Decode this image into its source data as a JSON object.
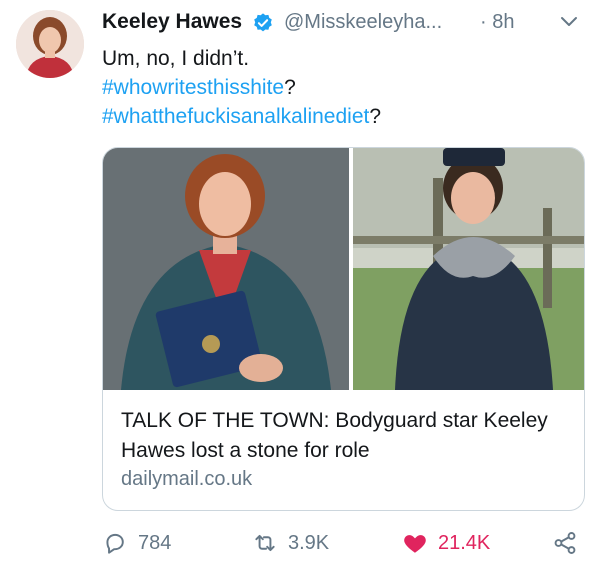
{
  "tweet": {
    "author_name": "Keeley Hawes",
    "handle": "@Misskeeleyha...",
    "separator": "·",
    "time": "8h",
    "text_line1": "Um, no, I didn’t.",
    "hashtag1": "#whowritesthisshite",
    "hashtag1_suffix": "?",
    "hashtag2": "#whatthefuckisanalkalinediet",
    "hashtag2_suffix": "?"
  },
  "card": {
    "title": "TALK OF THE TOWN: Bodyguard star Keeley Hawes lost a stone for role",
    "domain": "dailymail.co.uk"
  },
  "actions": {
    "replies": "784",
    "retweets": "3.9K",
    "likes": "21.4K",
    "liked": true
  },
  "colors": {
    "link": "#1da1f2",
    "like": "#e0245e",
    "secondary_text": "#657786",
    "border": "#ccd6dd"
  },
  "icons": [
    "verified-badge-icon",
    "chevron-down-icon",
    "reply-icon",
    "retweet-icon",
    "heart-icon",
    "share-icon"
  ]
}
